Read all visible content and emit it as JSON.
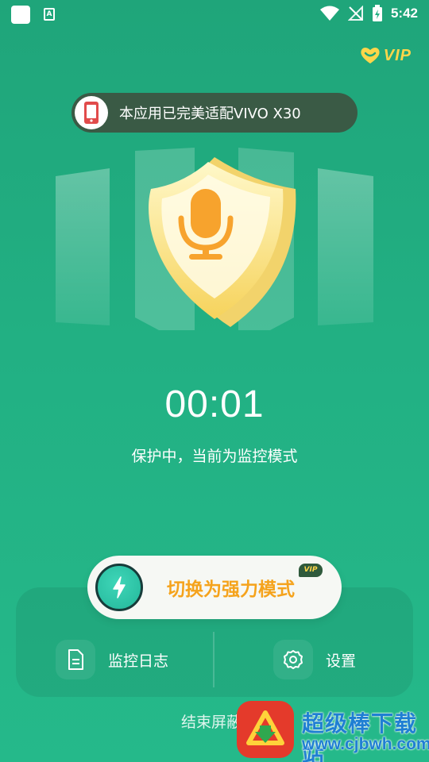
{
  "status_bar": {
    "a_badge": "A",
    "time": "5:42"
  },
  "vip": {
    "label": "VIP"
  },
  "banner": {
    "text": "本应用已完美适配VIVO X30"
  },
  "timer": {
    "value": "00:01"
  },
  "status_text": "保护中，当前为监控模式",
  "switch_button": {
    "label": "切换为强力模式",
    "badge": "VIP"
  },
  "panel": {
    "log_label": "监控日志",
    "settings_label": "设置"
  },
  "end_text": "结束屏蔽",
  "watermark": {
    "title": "超级棒下载站",
    "url": "www.cjbwh.com"
  },
  "colors": {
    "background": "#22b083",
    "accent_orange": "#f5a31c",
    "vip_gold": "#ffd64a"
  }
}
